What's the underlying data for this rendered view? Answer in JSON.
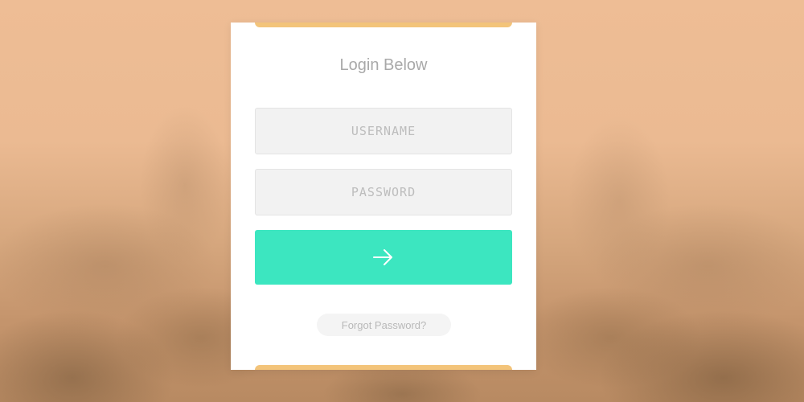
{
  "login": {
    "title": "Login Below",
    "username_placeholder": "USERNAME",
    "password_placeholder": "PASSWORD",
    "submit_icon": "arrow-right-icon",
    "forgot_label": "Forgot Password?"
  },
  "colors": {
    "background": "#e9b98f",
    "card": "#ffffff",
    "accent": "#f3c47a",
    "submit": "#3ce6c0",
    "field_bg": "#f2f2f2",
    "muted_text": "#a9a9a9"
  }
}
